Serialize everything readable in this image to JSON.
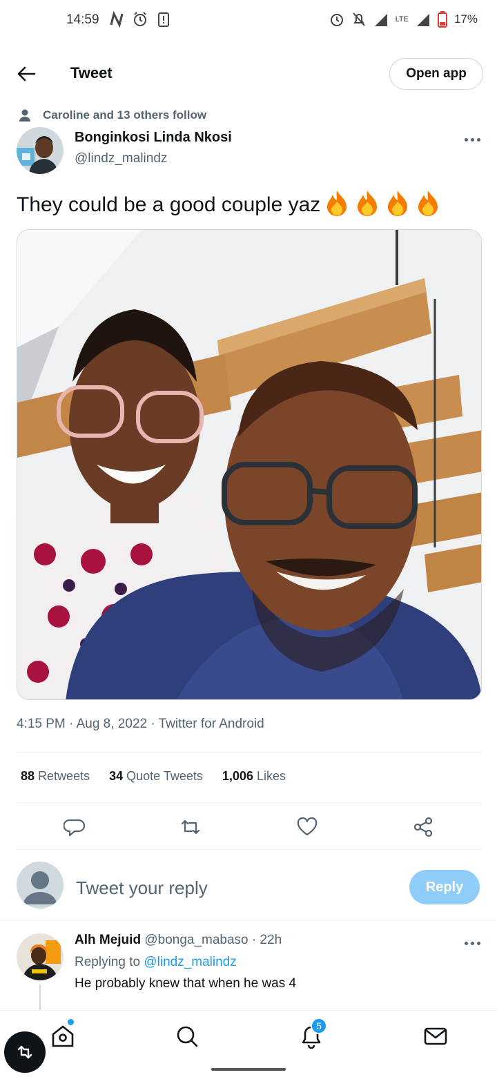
{
  "status_bar": {
    "time": "14:59",
    "battery_percent": "17%",
    "network": "LTE"
  },
  "header": {
    "title": "Tweet",
    "open_app_label": "Open app"
  },
  "tweet": {
    "social_context": "Caroline and 13 others follow",
    "author_name": "Bonginkosi Linda Nkosi",
    "author_handle": "@lindz_malindz",
    "text": "They could be a good couple yaz",
    "emoji": "fire x4",
    "meta": "4:15 PM · Aug 8, 2022 · Twitter for Android",
    "stats": {
      "retweets_count": "88",
      "retweets_label": "Retweets",
      "quotes_count": "34",
      "quotes_label": "Quote Tweets",
      "likes_count": "1,006",
      "likes_label": "Likes"
    }
  },
  "composer": {
    "placeholder": "Tweet your reply",
    "reply_button": "Reply"
  },
  "reply": {
    "name": "Alh Mejuid",
    "handle": "@bonga_mabaso",
    "separator": "·",
    "time": "22h",
    "replying_prefix": "Replying to",
    "replying_to": "@lindz_malindz",
    "text": "He probably knew that when he was 4"
  },
  "bottom_nav": {
    "items": [
      "home-icon",
      "search-icon",
      "notifications-icon",
      "messages-icon"
    ],
    "notification_count": "5"
  },
  "colors": {
    "accent": "#1d9bf0",
    "reply_button_disabled": "#8ecdf8",
    "secondary_text": "#536471"
  }
}
